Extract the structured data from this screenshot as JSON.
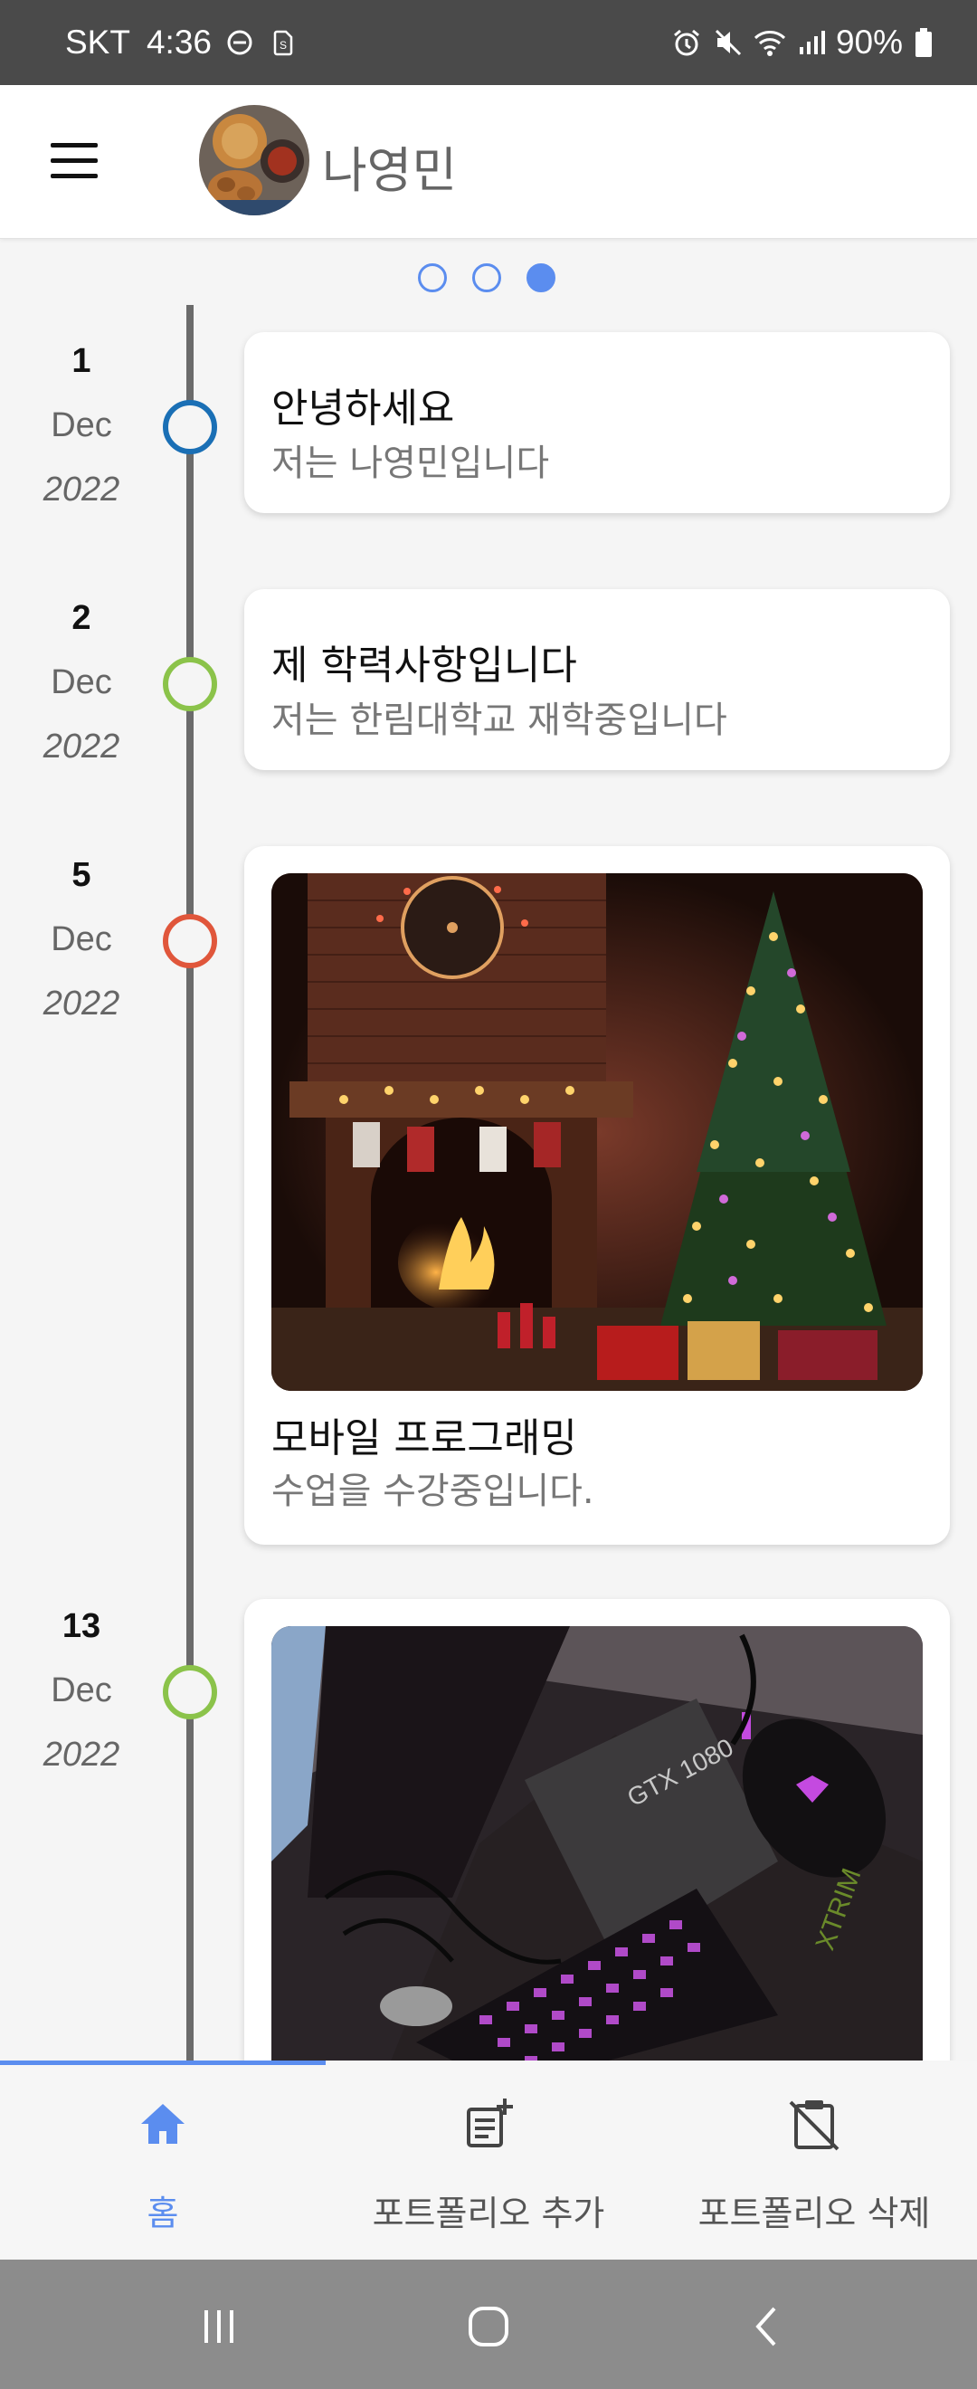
{
  "status_bar": {
    "carrier": "SKT",
    "time": "4:36",
    "battery": "90%",
    "icons": [
      "do-not-disturb-icon",
      "sim-icon",
      "alarm-icon",
      "mute-icon",
      "wifi-icon",
      "signal-icon",
      "battery-icon"
    ]
  },
  "appbar": {
    "username": "나영민",
    "menu_icon": "hamburger-menu-icon"
  },
  "pager": {
    "count": 3,
    "active_index": 2,
    "color": "#5b8def"
  },
  "timeline": [
    {
      "day": "1",
      "month": "Dec",
      "year": "2022",
      "node_color": "#1a6fb5",
      "title": "안녕하세요",
      "subtitle": "저는 나영민입니다",
      "image": null
    },
    {
      "day": "2",
      "month": "Dec",
      "year": "2022",
      "node_color": "#8bc34a",
      "title": "제 학력사항입니다",
      "subtitle": "저는 한림대학교 재학중입니다",
      "image": null
    },
    {
      "day": "5",
      "month": "Dec",
      "year": "2022",
      "node_color": "#e0563b",
      "title": "모바일 프로그래밍",
      "subtitle": "수업을 수강중입니다.",
      "image": "christmas-fireplace-photo"
    },
    {
      "day": "13",
      "month": "Dec",
      "year": "2022",
      "node_color": "#8bc34a",
      "title": "",
      "subtitle": "",
      "image": "keyboard-mouse-photo"
    }
  ],
  "bottom_nav": {
    "items": [
      {
        "label": "홈",
        "icon": "home-icon",
        "active": true
      },
      {
        "label": "포트폴리오 추가",
        "icon": "note-add-icon",
        "active": false
      },
      {
        "label": "포트폴리오 삭제",
        "icon": "clipboard-remove-icon",
        "active": false
      }
    ],
    "accent": "#5b8def"
  },
  "system_nav": {
    "icons": [
      "recent-apps-icon",
      "home-button-icon",
      "back-icon"
    ]
  }
}
